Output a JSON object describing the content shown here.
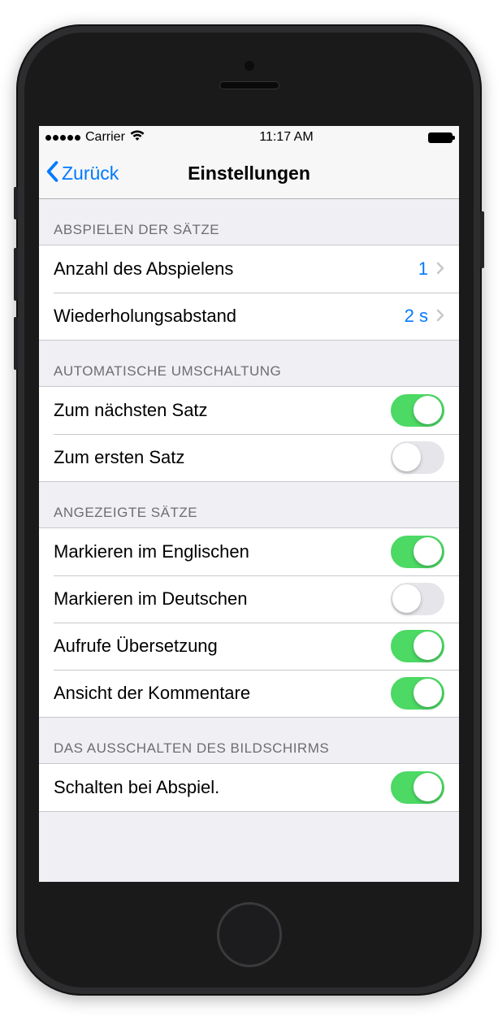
{
  "status": {
    "carrier": "Carrier",
    "time": "11:17 AM"
  },
  "nav": {
    "back": "Zurück",
    "title": "Einstellungen"
  },
  "sections": {
    "play": {
      "header": "ABSPIELEN DER SÄTZE",
      "rows": {
        "count": {
          "label": "Anzahl des Abspielens",
          "value": "1"
        },
        "interval": {
          "label": "Wiederholungsabstand",
          "value": "2 s"
        }
      }
    },
    "auto": {
      "header": "AUTOMATISCHE UMSCHALTUNG",
      "rows": {
        "next": {
          "label": "Zum nächsten Satz",
          "on": true
        },
        "first": {
          "label": "Zum ersten Satz",
          "on": false
        }
      }
    },
    "shown": {
      "header": "ANGEZEIGTE SÄTZE",
      "rows": {
        "en": {
          "label": "Markieren im Englischen",
          "on": true
        },
        "de": {
          "label": "Markieren im Deutschen",
          "on": false
        },
        "trans": {
          "label": "Aufrufe Übersetzung",
          "on": true
        },
        "comments": {
          "label": "Ansicht der Kommentare",
          "on": true
        }
      }
    },
    "screen": {
      "header": "DAS AUSSCHALTEN DES BILDSCHIRMS",
      "rows": {
        "disable": {
          "label": "Schalten bei Abspiel.",
          "on": true
        }
      }
    }
  }
}
